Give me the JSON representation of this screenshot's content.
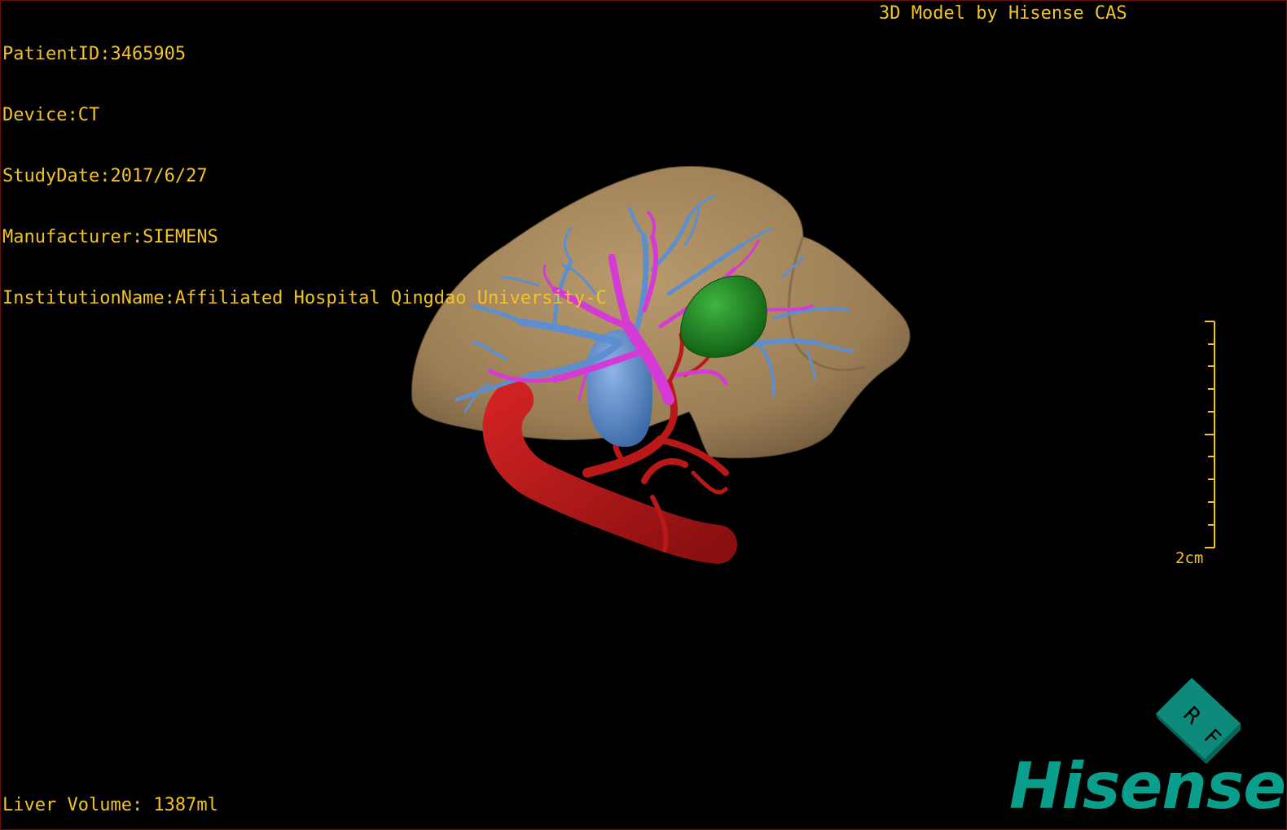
{
  "overlay": {
    "patient_id": "PatientID:3465905",
    "device": "Device:CT",
    "study_date": "StudyDate:2017/6/27",
    "manufacturer": "Manufacturer:SIEMENS",
    "institution": "InstitutionName:Affiliated Hospital Qingdao University-C",
    "model_credit": "3D Model by Hisense CAS",
    "liver_volume": "Liver Volume: 1387ml"
  },
  "scale": {
    "label": "2cm"
  },
  "orientation_cube": {
    "letters": [
      "R",
      "F"
    ]
  },
  "logo": {
    "text": "Hisense"
  },
  "colors": {
    "overlay_text": "#f2c326",
    "liver": "#a0825a",
    "portal_vein": "#5d8fd0",
    "hepatic_vein": "#d63ad6",
    "artery": "#b81818",
    "tumor": "#1f8a1f",
    "brand": "#0a9e8c"
  }
}
